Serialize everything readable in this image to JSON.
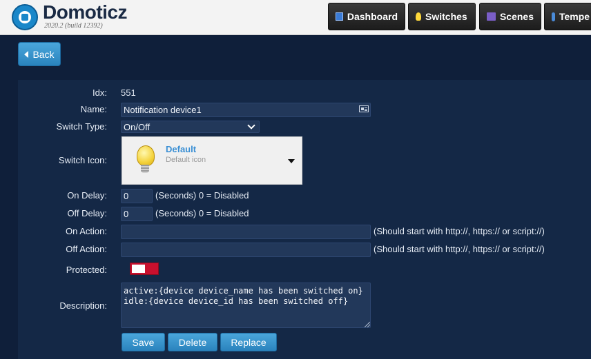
{
  "header": {
    "app_name": "Domoticz",
    "version": "2020.2 (build 12392)",
    "nav": [
      {
        "label": "Dashboard",
        "icon": "dashboard-icon"
      },
      {
        "label": "Switches",
        "icon": "lightbulb-icon"
      },
      {
        "label": "Scenes",
        "icon": "scenes-icon"
      },
      {
        "label": "Tempe",
        "icon": "thermometer-icon"
      }
    ]
  },
  "back_label": "Back",
  "form": {
    "idx_label": "Idx:",
    "idx_value": "551",
    "name_label": "Name:",
    "name_value": "Notification device1",
    "switch_type_label": "Switch Type:",
    "switch_type_value": "On/Off",
    "switch_icon_label": "Switch Icon:",
    "icon_name": "Default",
    "icon_desc": "Default icon",
    "on_delay_label": "On Delay:",
    "on_delay_value": "0",
    "on_delay_hint": "(Seconds) 0 = Disabled",
    "off_delay_label": "Off Delay:",
    "off_delay_value": "0",
    "off_delay_hint": "(Seconds) 0 = Disabled",
    "on_action_label": "On Action:",
    "on_action_value": "",
    "on_action_hint": "(Should start with http://, https:// or script://)",
    "off_action_label": "Off Action:",
    "off_action_value": "",
    "off_action_hint": "(Should start with http://, https:// or script://)",
    "protected_label": "Protected:",
    "protected_on": false,
    "description_label": "Description:",
    "description_value": "active:{device device_name has been switched on}\nidle:{device device_id has been switched off}"
  },
  "buttons": {
    "save": "Save",
    "delete": "Delete",
    "replace": "Replace"
  },
  "colors": {
    "background": "#0f1f3a",
    "panel": "#142846",
    "button_blue": "#2a83bd",
    "toggle_red": "#c8102e"
  }
}
